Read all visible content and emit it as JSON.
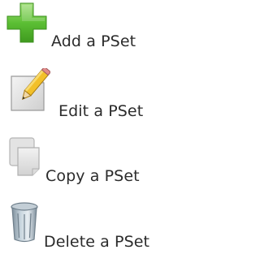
{
  "menu": {
    "items": [
      {
        "label": "Add a PSet",
        "icon": "plus-icon"
      },
      {
        "label": "Edit a PSet",
        "icon": "pencil-icon"
      },
      {
        "label": "Copy a PSet",
        "icon": "copy-icon"
      },
      {
        "label": "Delete a PSet",
        "icon": "trash-icon"
      }
    ]
  },
  "colors": {
    "text": "#2b2b2b",
    "plus_green": "#4cae2a",
    "plus_green_light": "#8ed36a",
    "pencil_yellow": "#f2c02a",
    "paper_gray": "#dcdcdc",
    "trash_blue_gray": "#a8b8c4"
  }
}
